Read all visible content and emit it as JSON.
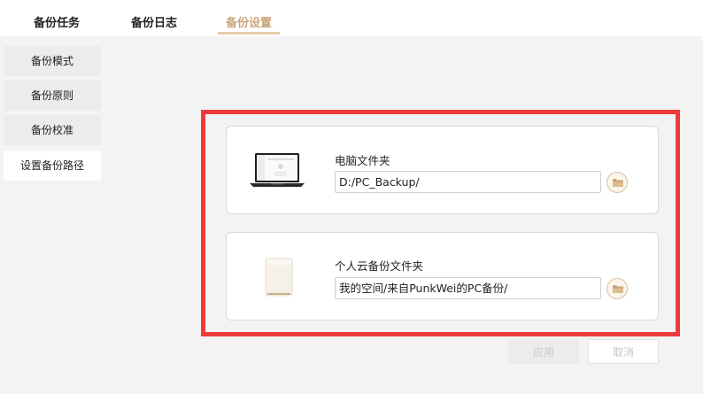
{
  "tabs": [
    {
      "label": "备份任务"
    },
    {
      "label": "备份日志"
    },
    {
      "label": "备份设置"
    }
  ],
  "sidebar": {
    "items": [
      {
        "label": "备份模式"
      },
      {
        "label": "备份原则"
      },
      {
        "label": "备份校准"
      },
      {
        "label": "设置备份路径"
      }
    ]
  },
  "cards": [
    {
      "label": "电脑文件夹",
      "path": "D:/PC_Backup/",
      "icon": "laptop-icon"
    },
    {
      "label": "个人云备份文件夹",
      "path": "我的空间/来自PunkWei的PC备份/",
      "icon": "cloud-device-icon"
    }
  ],
  "actions": {
    "apply_label": "应用",
    "cancel_label": "取消"
  },
  "colors": {
    "accent": "#c9a57a",
    "highlight_border": "#ee3b3b"
  }
}
